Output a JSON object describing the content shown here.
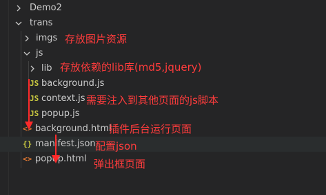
{
  "tree": {
    "items": [
      {
        "label": "Demo2",
        "icon": "chevron-right",
        "kind": "folder"
      },
      {
        "label": "trans",
        "icon": "chevron-down",
        "kind": "folder"
      },
      {
        "label": "imgs",
        "icon": "chevron-right",
        "kind": "folder"
      },
      {
        "label": "js",
        "icon": "chevron-down",
        "kind": "folder"
      },
      {
        "label": "lib",
        "icon": "chevron-right",
        "kind": "folder"
      },
      {
        "label": "background.js",
        "icon": "js-file",
        "glyph": "JS",
        "kind": "file"
      },
      {
        "label": "context.js",
        "icon": "js-file",
        "glyph": "JS",
        "kind": "file"
      },
      {
        "label": "popup.js",
        "icon": "js-file",
        "glyph": "JS",
        "kind": "file"
      },
      {
        "label": "background.html",
        "icon": "html-file",
        "glyph": "<>",
        "kind": "file"
      },
      {
        "label": "manifest.json",
        "icon": "json-file",
        "glyph": "{}",
        "kind": "file"
      },
      {
        "label": "popup.html",
        "icon": "html-file",
        "glyph": "<>",
        "kind": "file"
      }
    ]
  },
  "annotations": {
    "imgs": "存放图片资源",
    "lib": "存放依赖的lib库(md5,jquery)",
    "scripts": "需要注入到其他页面的js脚本",
    "background": "插件后台运行页面",
    "manifest": "配置json",
    "popup": "弹出框页面"
  },
  "colors": {
    "background": "#252526",
    "text": "#cccccc",
    "annotation": "#ff3c3c",
    "js_icon": "#cbcb41",
    "html_icon": "#e37933",
    "json_icon": "#cbcb41"
  }
}
